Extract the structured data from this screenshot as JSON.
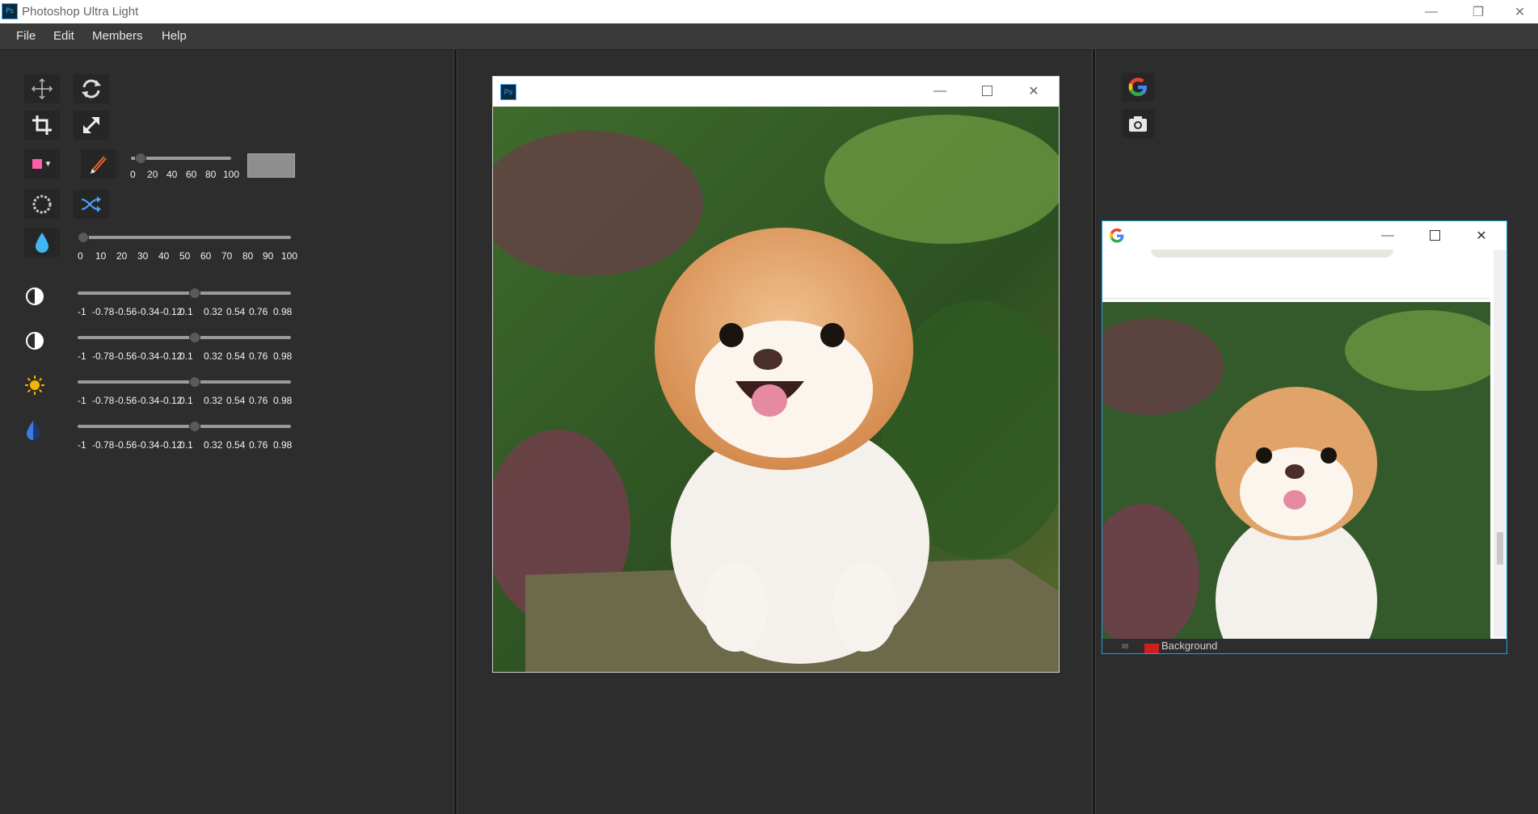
{
  "app": {
    "title": "Photoshop Ultra Light",
    "icon_text": "Ps"
  },
  "window_controls": {
    "minimize": "—",
    "restore": "❐",
    "close": "✕"
  },
  "menu": [
    "File",
    "Edit",
    "Members",
    "Help"
  ],
  "tools": {
    "row1": [
      "move-icon",
      "rotate-icon"
    ],
    "row2": [
      "crop-icon",
      "resize-icon"
    ],
    "row3": [
      "color-picker",
      "brush-icon"
    ],
    "row4": [
      "blur-circle-icon",
      "shuffle-icon"
    ],
    "brush_colors": {
      "swatch": "#ff5fa8",
      "preview": "#8e8e8e"
    }
  },
  "brush_size_slider": {
    "value": 0,
    "ticks": [
      "0",
      "20",
      "40",
      "60",
      "80",
      "100"
    ]
  },
  "opacity_slider": {
    "value": 0,
    "ticks": [
      "0",
      "10",
      "20",
      "30",
      "40",
      "50",
      "60",
      "70",
      "80",
      "90",
      "100"
    ]
  },
  "adjust_sliders": [
    {
      "name": "contrast",
      "icon": "contrast-icon",
      "value": 0.1,
      "ticks": [
        "-1",
        "-0.78",
        "-0.56",
        "-0.34",
        "-0.12",
        "0.1",
        "0.32",
        "0.54",
        "0.76",
        "0.98"
      ]
    },
    {
      "name": "gamma",
      "icon": "half-circle-icon",
      "value": 0.1,
      "ticks": [
        "-1",
        "-0.78",
        "-0.56",
        "-0.34",
        "-0.12",
        "0.1",
        "0.32",
        "0.54",
        "0.76",
        "0.98"
      ]
    },
    {
      "name": "brightness",
      "icon": "sun-icon",
      "value": 0.1,
      "ticks": [
        "-1",
        "-0.78",
        "-0.56",
        "-0.34",
        "-0.12",
        "0.1",
        "0.32",
        "0.54",
        "0.76",
        "0.98"
      ]
    },
    {
      "name": "saturation",
      "icon": "droplet-half-icon",
      "value": 0.1,
      "ticks": [
        "-1",
        "-0.78",
        "-0.56",
        "-0.34",
        "-0.12",
        "0.1",
        "0.32",
        "0.54",
        "0.76",
        "0.98"
      ]
    }
  ],
  "right_tools": [
    "google-icon",
    "camera-icon"
  ],
  "image_window": {
    "icon_text": "Ps"
  },
  "google_window": {
    "footer_text": "Background"
  },
  "colors": {
    "accent": "#31a8ff",
    "bg": "#2d2d2d",
    "panel_dark": "#262626"
  }
}
